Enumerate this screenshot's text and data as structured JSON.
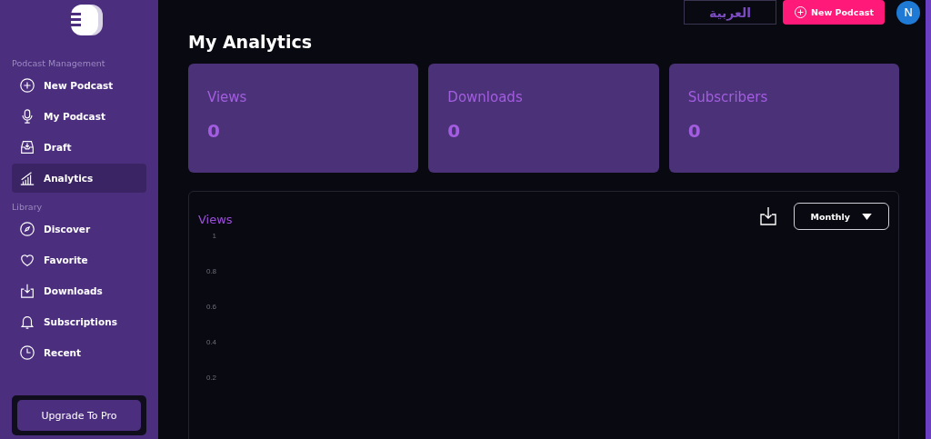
{
  "sidebar": {
    "sections": [
      {
        "title": "Podcast Management",
        "items": [
          {
            "label": "New Podcast",
            "kind": "plus",
            "selected": false
          },
          {
            "label": "My Podcast",
            "kind": "mic",
            "selected": false
          },
          {
            "label": "Draft",
            "kind": "inbox",
            "selected": false
          },
          {
            "label": "Analytics",
            "kind": "chart",
            "selected": true
          }
        ]
      },
      {
        "title": "Library",
        "items": [
          {
            "label": "Discover",
            "kind": "compass",
            "selected": false
          },
          {
            "label": "Favorite",
            "kind": "heart",
            "selected": false
          },
          {
            "label": "Downloads",
            "kind": "download",
            "selected": false
          },
          {
            "label": "Subscriptions",
            "kind": "bell",
            "selected": false
          },
          {
            "label": "Recent",
            "kind": "clock",
            "selected": false
          }
        ]
      }
    ],
    "upgrade_button": "Upgrade To Pro"
  },
  "header": {
    "language_button": "العربية",
    "new_podcast_button": "New Podcast",
    "avatar": "N"
  },
  "page_title": "My Analytics",
  "stats": [
    {
      "label": "Views",
      "value": "0"
    },
    {
      "label": "Downloads",
      "value": "0"
    },
    {
      "label": "Subscribers",
      "value": "0"
    }
  ],
  "chart_panel": {
    "title": "Views",
    "period": "Monthly",
    "y_axis_labels": [
      "1",
      "0.8",
      "0.6",
      "0.4",
      "0.2"
    ]
  }
}
